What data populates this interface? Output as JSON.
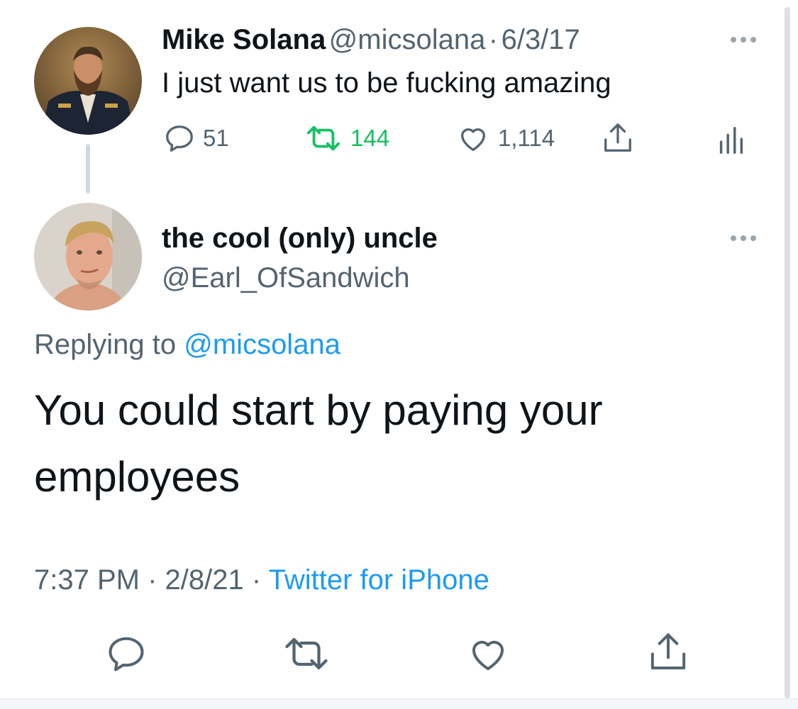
{
  "parent_tweet": {
    "name": "Mike Solana",
    "handle": "@micsolana",
    "separator": "·",
    "date": "6/3/17",
    "text": "I just want us to be fucking amazing",
    "replies": "51",
    "retweets": "144",
    "likes": "1,114"
  },
  "reply_tweet": {
    "name": "the cool (only) uncle",
    "handle": "@Earl_OfSandwich",
    "replying_prefix": "Replying to",
    "replying_handle": "@micsolana",
    "text_line1": "You could start by paying your",
    "text_line2": "employees",
    "time": "7:37 PM",
    "separator1": "·",
    "date": "2/8/21",
    "separator2": "·",
    "source": "Twitter for iPhone"
  },
  "colors": {
    "retweet_active": "#17bf63",
    "link": "#1d9bf0",
    "secondary_text": "#536471"
  },
  "icons": [
    "more-icon",
    "reply-icon",
    "retweet-icon",
    "like-icon",
    "share-icon",
    "analytics-icon"
  ]
}
